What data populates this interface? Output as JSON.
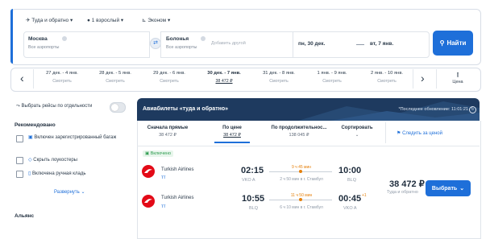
{
  "search": {
    "trip_type": "Туда и обратно",
    "passengers": "1 взрослый",
    "cabin": "Эконом",
    "from_city": "Москва",
    "from_sub": "Все аэропорты",
    "to_city": "Болонья",
    "to_sub": "Все аэропорты",
    "add_other": "Добавить другой",
    "date_out": "пн, 30 дек.",
    "date_back": "вт, 7 янв.",
    "search_label": "Найти"
  },
  "date_strip": {
    "items": [
      {
        "label": "27 дек. - 4 янв.",
        "price": "Смотреть"
      },
      {
        "label": "28 дек. - 5 янв.",
        "price": "Смотреть"
      },
      {
        "label": "29 дек. - 6 янв.",
        "price": "Смотреть"
      },
      {
        "label": "30 дек. - 7 янв.",
        "price": "38 472 ₽"
      },
      {
        "label": "31 дек. - 8 янв.",
        "price": "Смотреть"
      },
      {
        "label": "1 янв. - 9 янв.",
        "price": "Смотреть"
      },
      {
        "label": "2 янв. - 10 янв.",
        "price": "Смотреть"
      }
    ],
    "selected_index": 3,
    "price_chart_label": "Цена"
  },
  "left_panel": {
    "separate_flights": "Выбрать рейсы по отдельности",
    "recommended_title": "Рекомендовано",
    "options": [
      "Включен зарегистрированный багаж",
      "Скрыть лоукостеры",
      "Включена ручная кладь"
    ],
    "expand": "Развернуть",
    "alliance_title": "Альянс"
  },
  "results": {
    "header_title": "Авиабилеты «туда и обратно»",
    "last_update": "*Последнее обновление: 11:01:21",
    "sort": [
      {
        "label": "Сначала прямые",
        "price": "38 472 ₽"
      },
      {
        "label": "По цене",
        "price": "38 472 ₽"
      },
      {
        "label": "По продолжительнос...",
        "price": "138 045 ₽"
      },
      {
        "label": "Сортировать",
        "price": ""
      }
    ],
    "track_price": "Следить за ценой",
    "badge": "Включено",
    "flights": [
      {
        "airline": "Turkish Airlines",
        "dep_time": "02:15",
        "dep_code": "VKO A",
        "duration": "9 ч 45 мин",
        "stops": "2 ч 50 мин в г. Стамбул",
        "arr_time": "10:00",
        "arr_code": "BLQ",
        "day_offset": ""
      },
      {
        "airline": "Turkish Airlines",
        "dep_time": "10:55",
        "dep_code": "BLQ",
        "duration": "11 ч 50 мин",
        "stops": "6 ч 10 мин в г. Стамбул",
        "arr_time": "00:45",
        "arr_code": "VKO A",
        "day_offset": "+1"
      }
    ],
    "price": "38 472 ₽",
    "price_note": "Туда и обратно",
    "select_label": "Выбрать"
  },
  "colors": {
    "accent": "#1e6fd9",
    "header_bg": "#1e3a5f",
    "duration": "#e5800b",
    "turkish_red": "#e30a17"
  }
}
